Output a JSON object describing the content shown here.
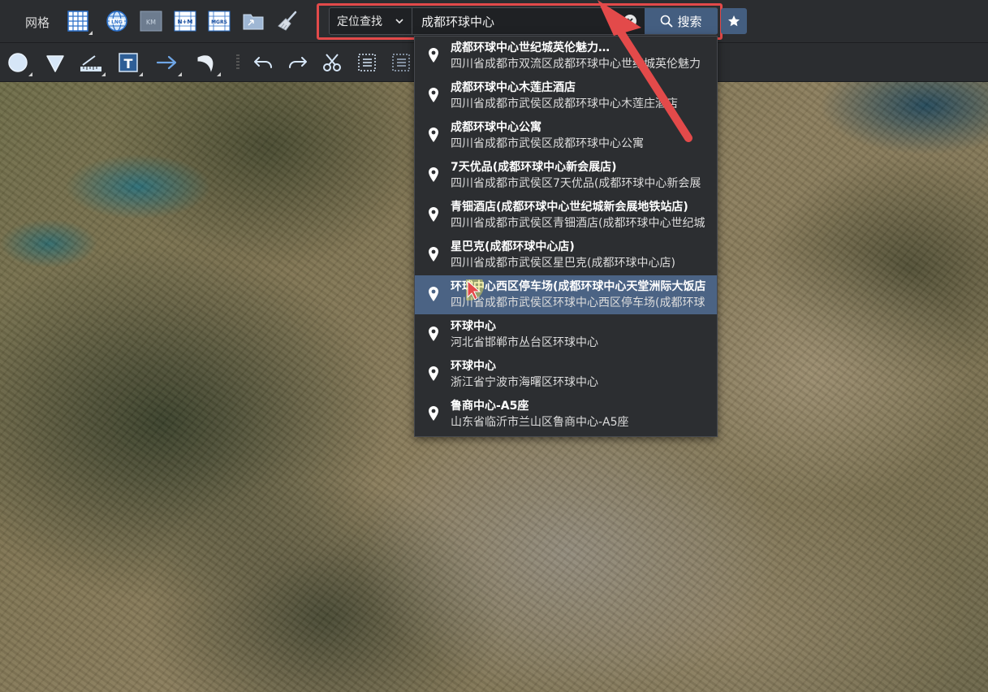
{
  "toolbar": {
    "grid_label": "网格",
    "tools_row1": [
      {
        "icon": "grid-table-icon"
      },
      {
        "icon": "globe-lnglat-icon",
        "text": "LNG"
      },
      {
        "icon": "km-grid-icon",
        "text": "KM"
      },
      {
        "icon": "nm-grid-icon",
        "text": "N+M"
      },
      {
        "icon": "mgrs-grid-icon",
        "text": "MGRS"
      },
      {
        "icon": "folder-icon"
      },
      {
        "icon": "broom-icon"
      }
    ],
    "tools_row2": [
      {
        "icon": "circle-draw-icon"
      },
      {
        "icon": "shield-draw-icon"
      },
      {
        "icon": "measure-ruler-icon"
      },
      {
        "icon": "text-frame-icon",
        "text": "T"
      },
      {
        "icon": "arrow-draw-icon"
      },
      {
        "icon": "curve-draw-icon"
      },
      {
        "icon": "undo-icon"
      },
      {
        "icon": "redo-icon"
      },
      {
        "icon": "scissors-icon"
      },
      {
        "icon": "list-select-icon"
      },
      {
        "icon": "list-clear-icon"
      }
    ]
  },
  "search": {
    "mode": "定位查找",
    "query": "成都环球中心",
    "button_label": "搜索"
  },
  "results": [
    {
      "name": "成都环球中心世纪城英伦魅力…",
      "address": "四川省成都市双流区成都环球中心世纪城英伦魅力",
      "active": false
    },
    {
      "name": "成都环球中心木莲庄酒店",
      "address": "四川省成都市武侯区成都环球中心木莲庄酒店",
      "active": false
    },
    {
      "name": "成都环球中心公寓",
      "address": "四川省成都市武侯区成都环球中心公寓",
      "active": false
    },
    {
      "name": "7天优品(成都环球中心新会展店)",
      "address": "四川省成都市武侯区7天优品(成都环球中心新会展",
      "active": false
    },
    {
      "name": "青钿酒店(成都环球中心世纪城新会展地铁站店)",
      "address": "四川省成都市武侯区青钿酒店(成都环球中心世纪城",
      "active": false
    },
    {
      "name": "星巴克(成都环球中心店)",
      "address": "四川省成都市武侯区星巴克(成都环球中心店)",
      "active": false
    },
    {
      "name": "环球中心西区停车场(成都环球中心天堂洲际大饭店",
      "address": "四川省成都市武侯区环球中心西区停车场(成都环球",
      "active": true
    },
    {
      "name": "环球中心",
      "address": "河北省邯郸市丛台区环球中心",
      "active": false
    },
    {
      "name": "环球中心",
      "address": "浙江省宁波市海曙区环球中心",
      "active": false
    },
    {
      "name": "鲁商中心-A5座",
      "address": "山东省临沂市兰山区鲁商中心-A5座",
      "active": false
    }
  ],
  "colors": {
    "toolbar_bg": "#2b2d30",
    "accent": "#445e80",
    "highlight": "#e34a4a"
  }
}
